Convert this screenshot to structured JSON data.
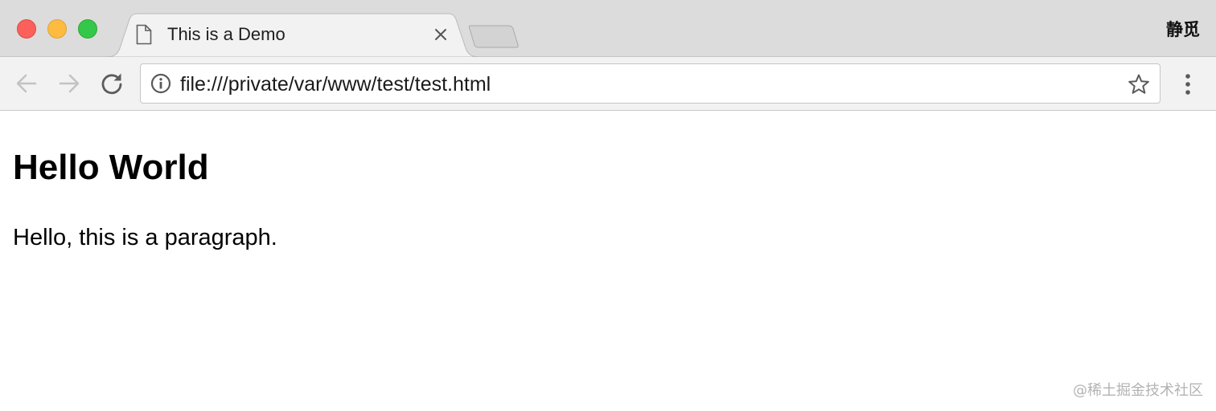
{
  "window": {
    "controls": {
      "close_color": "#fc605b",
      "minimize_color": "#fdbc40",
      "maximize_color": "#34c84a"
    },
    "profile_name": "静觅"
  },
  "tabs": [
    {
      "title": "This is a Demo",
      "icon": "document-icon",
      "active": true
    }
  ],
  "toolbar": {
    "back_icon": "arrow-left-icon",
    "forward_icon": "arrow-right-icon",
    "reload_icon": "reload-icon",
    "address": {
      "url": "file:///private/var/www/test/test.html",
      "info_icon": "info-icon",
      "bookmark_icon": "star-icon"
    },
    "menu_icon": "more-vertical-icon"
  },
  "page": {
    "heading": "Hello World",
    "paragraph": "Hello, this is a paragraph."
  },
  "watermark": "@稀土掘金技术社区"
}
